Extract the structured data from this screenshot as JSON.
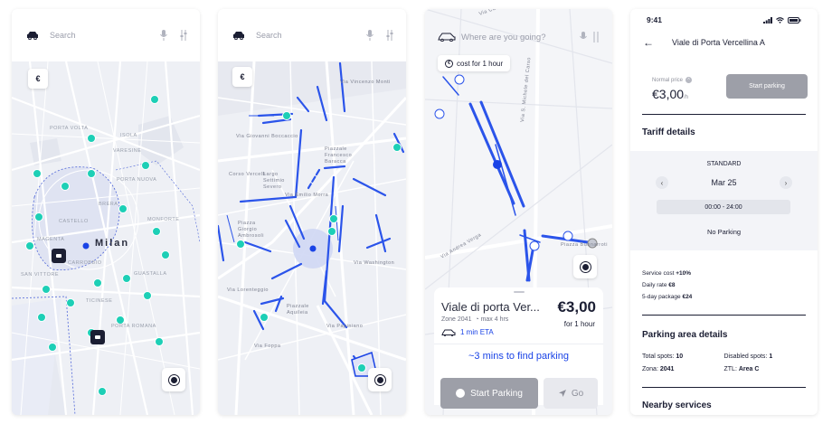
{
  "search": {
    "placeholder": "Search",
    "placeholder_s3": "Where are you going?"
  },
  "map": {
    "city": "Milan",
    "euro_label": "€"
  },
  "screen1_labels": [
    "PORTA VOLTA",
    "VARESINE",
    "ISOLA",
    "BRERA",
    "CASTELLO",
    "GUASTALLA",
    "TICINESE",
    "CARROBBIO",
    "SAN VITTORE",
    "MONFORTE",
    "PORTA NUOVA",
    "MAGENTA",
    "PORTA ROMANA"
  ],
  "screen2_labels": [
    "Piazzale Francesco Baracca",
    "Corso Vercelli",
    "Largo Settimio Severo",
    "Via Emilio Morra",
    "Piazza Giorgio Ambrosoli",
    "Piazzale Aquileia",
    "Via Papiniano",
    "Via Foppa",
    "Via Giovanni Boccaccio",
    "Via Vincenzo Monti",
    "Via Washington",
    "Via Lorenteggio"
  ],
  "screen3_labels": [
    "Via Andrea Verga",
    "Via S. Michele del Carso",
    "Via Carlo Ravizza",
    "Piazza Buonarroti"
  ],
  "screen3": {
    "cost_chip": "cost for 1 hour",
    "street": "Viale di porta Ver...",
    "zone": "Zone 2041",
    "max_hours": "max 4 hrs",
    "eta": "1 min ETA",
    "price": "€3,00",
    "per_hour": "for 1 hour",
    "find_text": "~3 mins to find parking",
    "start_label": "Start Parking",
    "go_label": "Go"
  },
  "screen4": {
    "time": "9:41",
    "title": "Viale di Porta Vercellina A",
    "normal_price_label": "Normal price",
    "normal_price": "€3,00",
    "per_hour_unit": "/h",
    "start_label": "Start parking",
    "tariff_title": "Tariff details",
    "tariff_type": "STANDARD",
    "date": "Mar 25",
    "time_range": "00:00 - 24:00",
    "no_parking": "No Parking",
    "service_cost_label": "Service cost",
    "service_cost_value": "+10%",
    "daily_rate_label": "Daily rate",
    "daily_rate_value": "€8",
    "package_label": "5-day package",
    "package_value": "€24",
    "area_title": "Parking area details",
    "total_spots_label": "Total spots:",
    "total_spots_value": "10",
    "disabled_spots_label": "Disabled spots:",
    "disabled_spots_value": "1",
    "zone_label": "Zona:",
    "zone_value": "2041",
    "ztl_label": "ZTL:",
    "ztl_value": "Area C",
    "nearby_title": "Nearby services"
  },
  "colors": {
    "accent": "#1a43e6",
    "teal": "#1dcfb6",
    "navy": "#1b1e33",
    "map_bg": "#f2f3f7"
  }
}
